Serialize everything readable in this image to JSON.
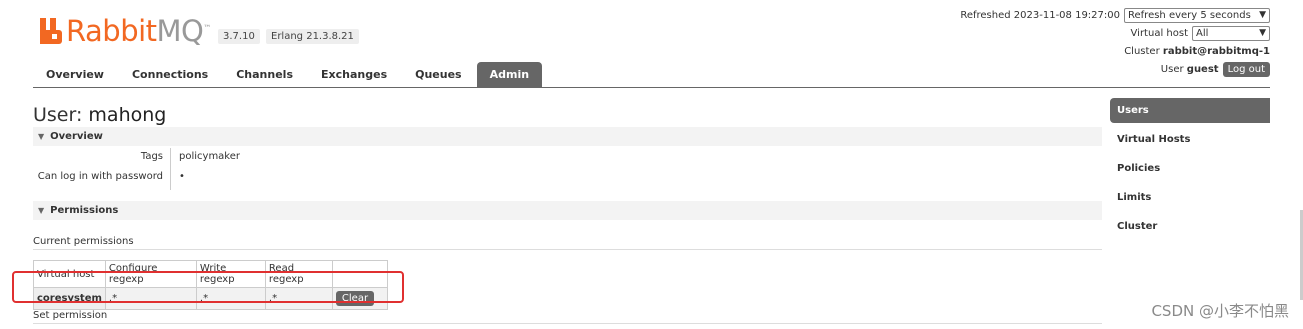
{
  "header": {
    "logo_rabbit": "Rabbit",
    "logo_mq": "MQ",
    "logo_tm": "™",
    "version": "3.7.10",
    "erlang": "Erlang 21.3.8.21",
    "refreshed_label": "Refreshed 2023-11-08 19:27:00",
    "refresh_select": "Refresh every 5 seconds",
    "vhost_label": "Virtual host",
    "vhost_select": "All",
    "cluster_label": "Cluster",
    "cluster_value": "rabbit@rabbitmq-1",
    "user_label": "User",
    "user_value": "guest",
    "logout": "Log out"
  },
  "tabs": [
    "Overview",
    "Connections",
    "Channels",
    "Exchanges",
    "Queues",
    "Admin"
  ],
  "active_tab": "Admin",
  "page": {
    "title_prefix": "User:",
    "title_name": "mahong",
    "overview_header": "Overview",
    "tags_label": "Tags",
    "tags_value": "policymaker",
    "login_label": "Can log in with password",
    "login_value": "•",
    "permissions_header": "Permissions",
    "current_permissions": "Current permissions",
    "set_permission": "Set permission"
  },
  "permissions_table": {
    "headers": [
      "Virtual host",
      "Configure regexp",
      "Write regexp",
      "Read regexp"
    ],
    "rows": [
      {
        "vhost": "coresystem",
        "configure": ".*",
        "write": ".*",
        "read": ".*",
        "action": "Clear"
      }
    ]
  },
  "sidebar": {
    "items": [
      "Users",
      "Virtual Hosts",
      "Policies",
      "Limits",
      "Cluster"
    ],
    "active": "Users"
  },
  "watermark": "CSDN @小李不怕黑",
  "colors": {
    "brand_orange": "#f26822",
    "tab_active": "#666666",
    "highlight_red": "#e03030"
  }
}
